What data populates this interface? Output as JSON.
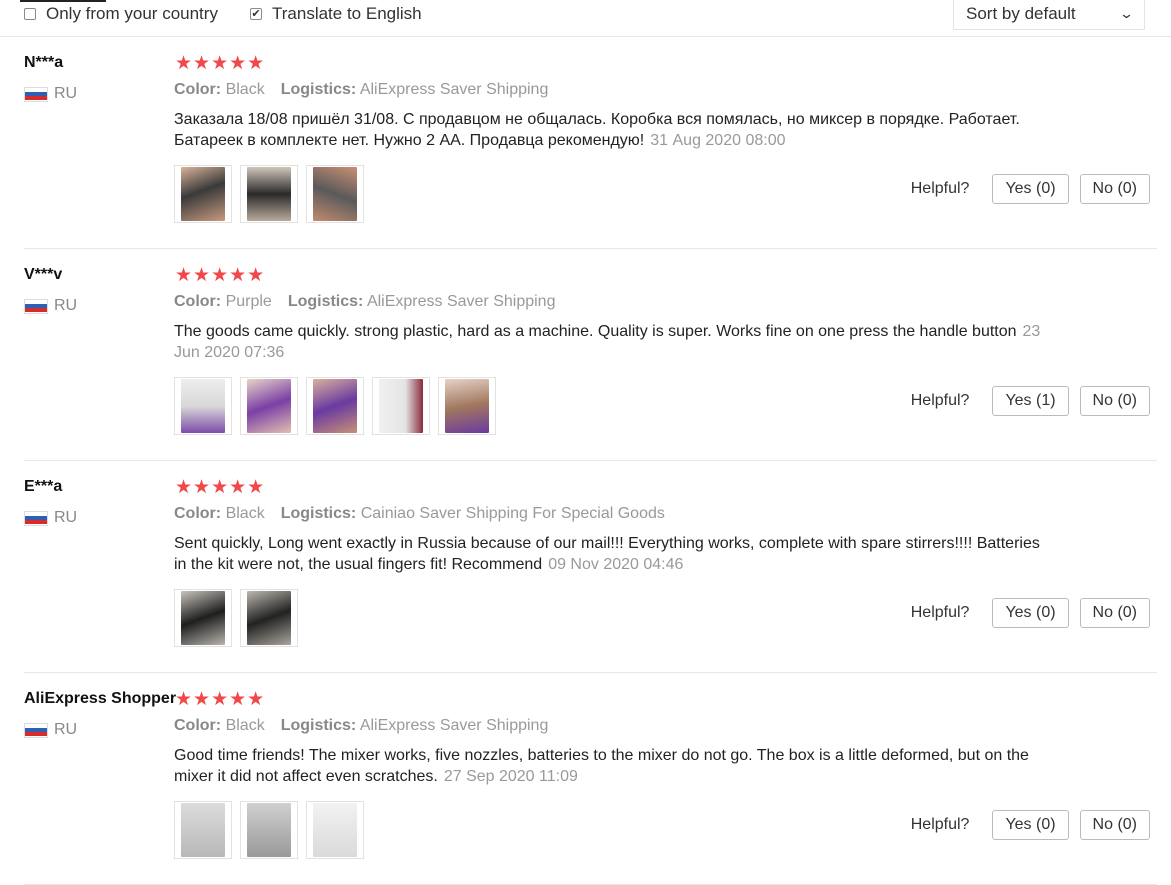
{
  "filters": {
    "only_country": {
      "label": "Only from your country",
      "checked": false
    },
    "translate": {
      "label": "Translate to English",
      "checked": true
    },
    "sort": {
      "selected": "Sort by default"
    }
  },
  "labels": {
    "color_key": "Color:",
    "logistics_key": "Logistics:",
    "helpful": "Helpful?"
  },
  "colors": {
    "star": "#f0484b",
    "separator": "#e8e8e8"
  },
  "reviews": [
    {
      "name": "N***a",
      "country": "RU",
      "rating": 5,
      "stars": "★★★★★",
      "color": "Black",
      "logistics": "AliExpress Saver Shipping",
      "text": "Заказала 18/08 пришёл 31/08. С продавцом не общалась. Коробка вся помялась, но миксер в порядке. Работает. Батареек в комплекте нет. Нужно 2 АА. Продавца рекомендую!",
      "date": "31 Aug 2020 08:00",
      "photos": [
        "photo-hand-mixer",
        "photo-mixer-stand",
        "photo-hand-package"
      ],
      "yes": "Yes (0)",
      "no": "No (0)"
    },
    {
      "name": "V***v",
      "country": "RU",
      "rating": 5,
      "stars": "★★★★★",
      "color": "Purple",
      "logistics": "AliExpress Saver Shipping",
      "text": "The goods came quickly. strong plastic, hard as a machine. Quality is super. Works fine on one press the handle button",
      "date": "23 Jun 2020 07:36",
      "photos": [
        "photo-box",
        "photo-purple-mixer",
        "photo-hand-purple",
        "photo-box-side",
        "photo-box-purple"
      ],
      "yes": "Yes (1)",
      "no": "No (0)"
    },
    {
      "name": "E***a",
      "country": "RU",
      "rating": 5,
      "stars": "★★★★★",
      "color": "Black",
      "logistics": "Cainiao Saver Shipping For Special Goods",
      "text": "Sent quickly, Long went exactly in Russia because of our mail!!! Everything works, complete with spare stirrers!!!! Batteries in the kit were not, the usual fingers fit! Recommend",
      "date": "09 Nov 2020 04:46",
      "photos": [
        "photo-black-mixer",
        "photo-black-mixer-2"
      ],
      "yes": "Yes (0)",
      "no": "No (0)"
    },
    {
      "name": "AliExpress Shopper",
      "country": "RU",
      "rating": 5,
      "stars": "★★★★★",
      "color": "Black",
      "logistics": "AliExpress Saver Shipping",
      "text": "Good time friends! The mixer works, five nozzles, batteries to the mixer do not go. The box is a little deformed, but on the mixer it did not affect even scratches.",
      "date": "27 Sep 2020 11:09",
      "photos": [
        "photo-whisks",
        "photo-mixer-grey",
        "photo-box-white"
      ],
      "yes": "Yes (0)",
      "no": "No (0)"
    }
  ]
}
